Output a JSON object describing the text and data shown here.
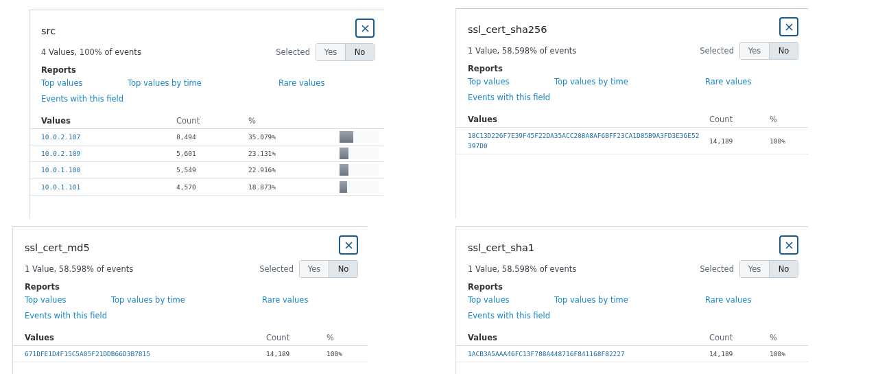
{
  "panels": [
    {
      "title": "src",
      "summary": "4 Values, 100% of events",
      "selected_label": "Selected",
      "toggle": [
        {
          "label": "Yes",
          "selected": false
        },
        {
          "label": "No",
          "selected": true
        }
      ],
      "reports_heading": "Reports",
      "reports": [
        "Top values",
        "Top values by time",
        "Rare values",
        "Events with this field"
      ],
      "columns": [
        "Values",
        "Count",
        "%"
      ],
      "rows": [
        {
          "value": "10.0.2.107",
          "count": "8,494",
          "percent": "35.079%",
          "level": 0.35079
        },
        {
          "value": "10.0.2.109",
          "count": "5,601",
          "percent": "23.131%",
          "level": 0.23131
        },
        {
          "value": "10.0.1.100",
          "count": "5,549",
          "percent": "22.916%",
          "level": 0.22916
        },
        {
          "value": "10.0.1.101",
          "count": "4,570",
          "percent": "18.873%",
          "level": 0.18873
        }
      ]
    },
    {
      "title": "ssl_cert_sha256",
      "summary": "1 Value, 58.598% of events",
      "selected_label": "Selected",
      "toggle": [
        {
          "label": "Yes",
          "selected": false
        },
        {
          "label": "No",
          "selected": true
        }
      ],
      "reports_heading": "Reports",
      "reports": [
        "Top values",
        "Top values by time",
        "Rare values",
        "Events with this field"
      ],
      "columns": [
        "Values",
        "Count",
        "%"
      ],
      "rows": [
        {
          "value": "18C13D226F7E39F45F22DA35ACC288A8AF6BFF23CA1D85B9A3FD3E36E52397D0",
          "count": "14,189",
          "percent": "100%"
        }
      ]
    },
    {
      "title": "ssl_cert_md5",
      "summary": "1 Value, 58.598% of events",
      "selected_label": "Selected",
      "toggle": [
        {
          "label": "Yes",
          "selected": false
        },
        {
          "label": "No",
          "selected": true
        }
      ],
      "reports_heading": "Reports",
      "reports": [
        "Top values",
        "Top values by time",
        "Rare values",
        "Events with this field"
      ],
      "columns": [
        "Values",
        "Count",
        "%"
      ],
      "rows": [
        {
          "value": "671DFE1D4F15C5A05F21DDB66D3B7815",
          "count": "14,189",
          "percent": "100%"
        }
      ]
    },
    {
      "title": "ssl_cert_sha1",
      "summary": "1 Value, 58.598% of events",
      "selected_label": "Selected",
      "toggle": [
        {
          "label": "Yes",
          "selected": false
        },
        {
          "label": "No",
          "selected": true
        }
      ],
      "reports_heading": "Reports",
      "reports": [
        "Top values",
        "Top values by time",
        "Rare values",
        "Events with this field"
      ],
      "columns": [
        "Values",
        "Count",
        "%"
      ],
      "rows": [
        {
          "value": "1ACB3A5AAA46FC13F788A448716F841168F82227",
          "count": "14,189",
          "percent": "100%"
        }
      ]
    }
  ]
}
